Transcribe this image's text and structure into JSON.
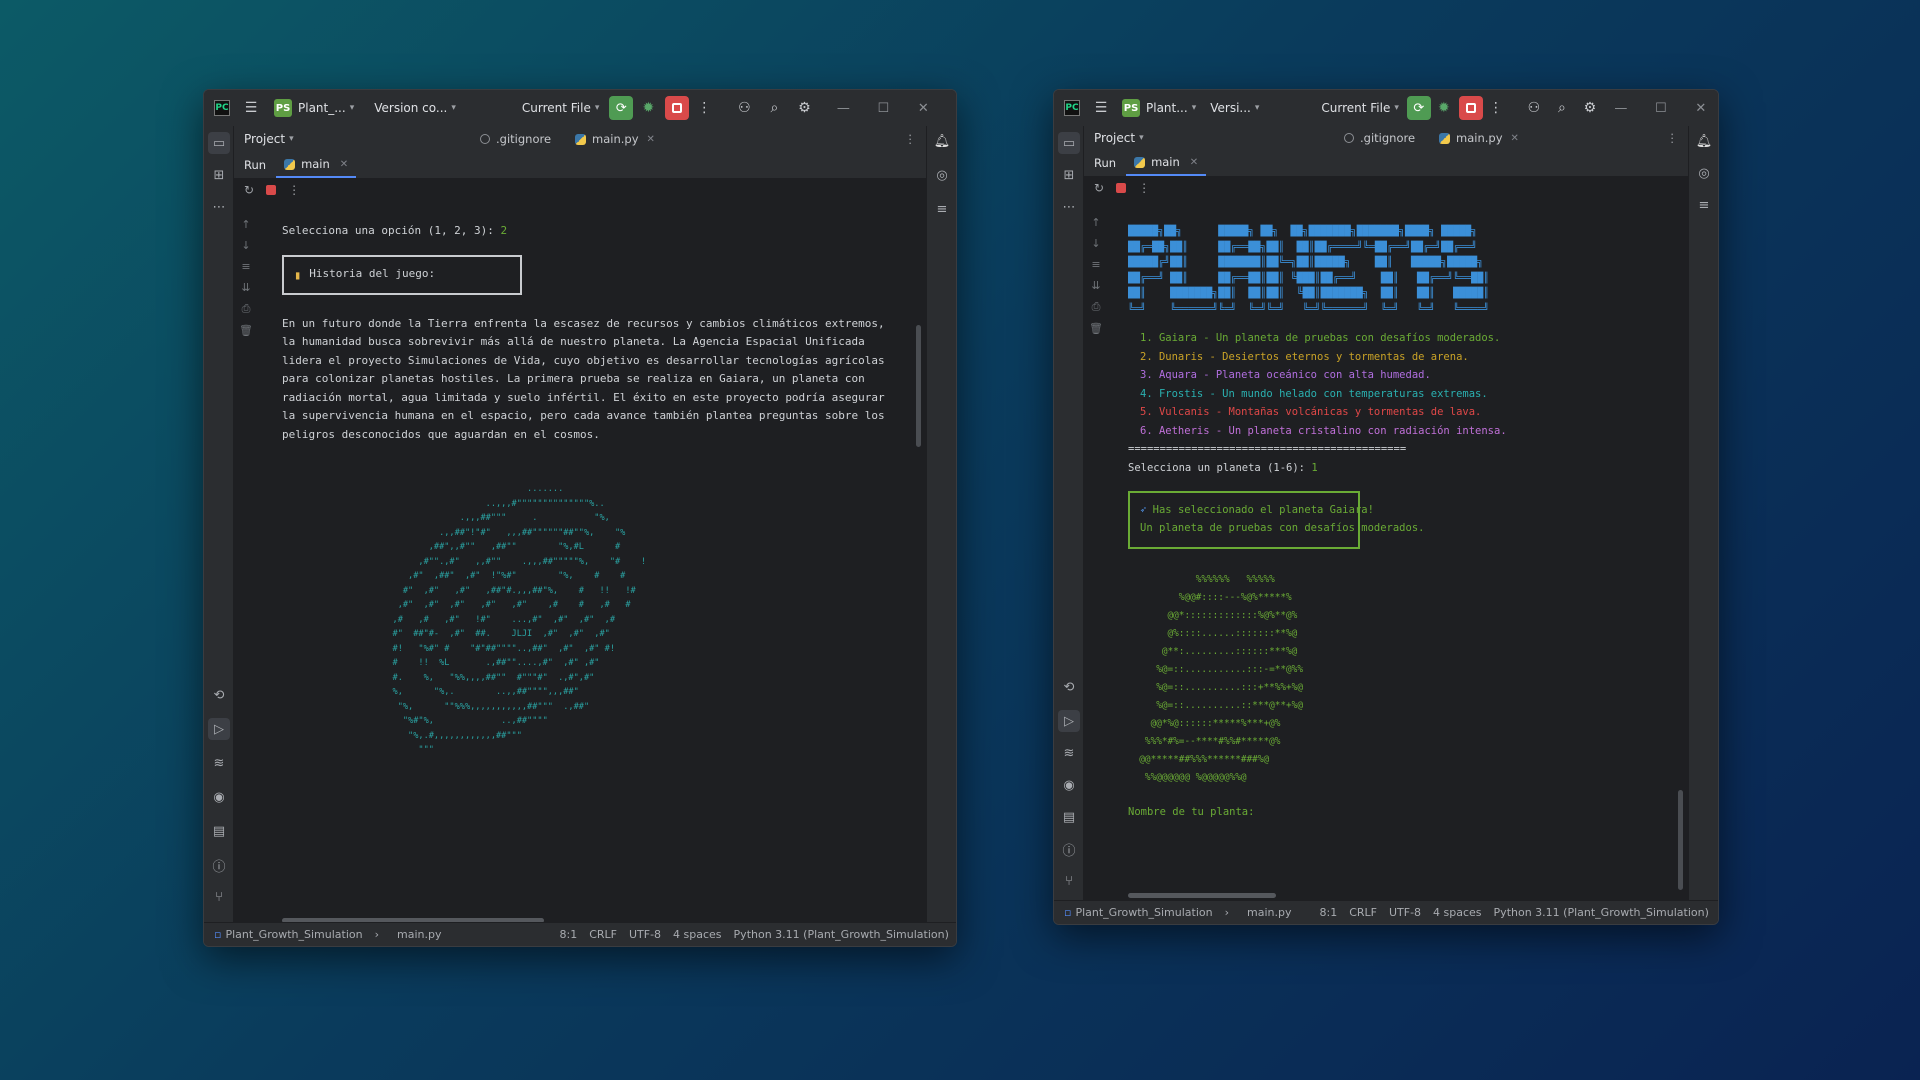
{
  "left_window": {
    "title": {
      "project": "Plant_...",
      "version_control": "Version co...",
      "run_config": "Current File",
      "project_badge": "PS"
    },
    "project_header": "Project",
    "tabs": [
      {
        "label": ".gitignore"
      },
      {
        "label": "main.py"
      }
    ],
    "run": {
      "run_label": "Run",
      "tab_label": "main"
    },
    "console": {
      "prompt": "Selecciona una opción (1, 2, 3): ",
      "prompt_input": "2",
      "box_text": "Historia del juego:",
      "story": [
        "En un futuro donde la Tierra enfrenta la escasez de recursos y cambios climáticos extremos,",
        "la humanidad busca sobrevivir más allá de nuestro planeta. La Agencia Espacial Unificada",
        "lidera el proyecto Simulaciones de Vida, cuyo objetivo es desarrollar tecnologías agrícolas",
        "para colonizar planetas hostiles. La primera prueba se realiza en Gaiara, un planeta con",
        "radiación mortal, agua limitada y suelo infértil. El éxito en este proyecto podría asegurar",
        "la supervivencia humana en el espacio, pero cada avance también plantea preguntas sobre los",
        "peligros desconocidos que aguardan en el cosmos."
      ],
      "ascii_art": "                             .......\n                     ..,,,#\"\"\"\"\"\"\"\"\"\"\"\"\"\"%..\n                .,,,##\"\"\"     .           \"%,\n            .,,##\"!\"#\"   ,,,##\"\"\"\"\"\"##\"\"%,    \"%\n          ,##\",,#\"\"   ,##\"\"        \"%,#L      #\n        ,#\"\".,#\"   ,,#\"\"    .,,,##\"\"\"\"\"%,    \"#    !\n      ,#\"  ,##\"  ,#\"  !\"%#\"        \"%,    #    #\n     #\"  ,#\"   ,#\"   ,##\"#.,,,##\"%,    #   !!   !#\n    ,#\"  ,#\"  ,#\"   ,#\"   ,#\"    ,#    #   ,#   #\n   ,#   ,#   ,#\"   !#\"    ...,#\"  ,#\"  ,#\"  ,#\n   #\"  ##\"#-  ,#\"  ##.    JLJI  ,#\"  ,#\"  ,#\"\n   #!   \"%#\" #    \"#\"##\"\"\"\"..,##\"  ,#\"  ,#\" #!\n   #    !!  %L       .,##\"\"....,#\"  ,#\" ,#\"\n   #.    %,   \"%%,,,,##\"\"  #\"\"\"#\"  .,#\",#\"\n   %,      \"%,.        ..,,##\"\"\"\",,,##\"\n    \"%,      \"\"%%%,,,,,,,,,,,##\"\"\"  .,##\"\n     \"%#\"%,             ..,##\"\"\"\"\n      \"%,.#,,,,,,,,,,,,##\"\"\"\n        \"\"\""
    },
    "status": {
      "project": "Plant_Growth_Simulation",
      "file": "main.py",
      "position": "8:1",
      "line_sep": "CRLF",
      "encoding": "UTF-8",
      "indent": "4 spaces",
      "interpreter": "Python 3.11 (Plant_Growth_Simulation)"
    }
  },
  "right_window": {
    "title": {
      "project": "Plant...",
      "version_control": "Versi...",
      "run_config": "Current File",
      "project_badge": "PS"
    },
    "project_header": "Project",
    "tabs": [
      {
        "label": ".gitignore"
      },
      {
        "label": "main.py"
      }
    ],
    "run": {
      "run_label": "Run",
      "tab_label": "main"
    },
    "console": {
      "banner": "█████╗██╗      █████╗ ██╗  ██╗███████╗███████╗████╗ █████╗\n██╔═██╗██║     ██╔══██╗██║  ██║██╔════╝╚═██╔══╝██╔═╝██╔══╝\n█████╔╝██║     ███████║██╚═╗██║█████╗    ██║   █████╗█████╗\n██╔══╝ ██║     ██╔══██║██║ ╚███║██╔══╝    ██║   ██╔══╝╚══██║\n██║    ███████╗██║  ██║██║  ╚██║███████╗  ██║   ██║   █████║\n╚═╝    ╚══════╝╚═╝  ╚═╝╚═╝   ╚═╝╚══════╝  ╚═╝   ╚═╝   ╚════╝",
      "planets": [
        {
          "text": "1. Gaiara - Un planeta de pruebas con desafíos moderados.",
          "color": "#6aab35"
        },
        {
          "text": "2. Dunaris - Desiertos eternos y tormentas de arena.",
          "color": "#c9a227"
        },
        {
          "text": "3. Aquara - Planeta oceánico con alta humedad.",
          "color": "#b06ee0"
        },
        {
          "text": "4. Frostis - Un mundo helado con temperaturas extremas.",
          "color": "#2ab0b0"
        },
        {
          "text": "5. Vulcanis - Montañas volcánicas y tormentas de lava.",
          "color": "#e04848"
        },
        {
          "text": "6. Aetheris - Un planeta cristalino con radiación intensa.",
          "color": "#c070d8"
        }
      ],
      "separator": "============================================",
      "prompt": "Selecciona un planeta (1-6): ",
      "prompt_input": "1",
      "selection_line1": "Has seleccionado el planeta Gaiara!",
      "selection_line2": "Un planeta de pruebas con desafíos moderados.",
      "plant_art": "            %%%%%%   %%%%%\n         %@@#::::---%@%*****%\n       @@*:::::::::::::%@%**@%\n       @%::::......:::::::**%@\n      @**:.........::::::***%@\n     %@=::...........:::-=**@%%\n     %@=::..........:::+**%%+%@\n     %@=::..........::***@**+%@\n    @@*%@::::::*****%***+@%\n   %%%*#%=--****#%%#*****@%\n  @@*****##%%%******###%@\n   %%@@@@@@ %@@@@@%%@",
      "name_prompt": "Nombre de tu planta:"
    },
    "status": {
      "project": "Plant_Growth_Simulation",
      "file": "main.py",
      "position": "8:1",
      "line_sep": "CRLF",
      "encoding": "UTF-8",
      "indent": "4 spaces",
      "interpreter": "Python 3.11 (Plant_Growth_Simulation)"
    }
  },
  "colors": {
    "accent_blue": "#548af7",
    "run_green": "#4f9b53",
    "stop_red": "#d94a4a",
    "console_green": "#6aab35",
    "banner_blue": "#3b8fd8",
    "art_teal": "#2aa3a3"
  },
  "icons": [
    "menu-icon",
    "run-icon",
    "debug-icon",
    "stop-icon",
    "more-icon",
    "add-user-icon",
    "search-icon",
    "settings-icon",
    "folder-icon",
    "structure-icon",
    "notifications-icon",
    "database-icon",
    "rerun-icon",
    "git-icon",
    "terminal-icon",
    "problems-icon",
    "layers-icon"
  ]
}
